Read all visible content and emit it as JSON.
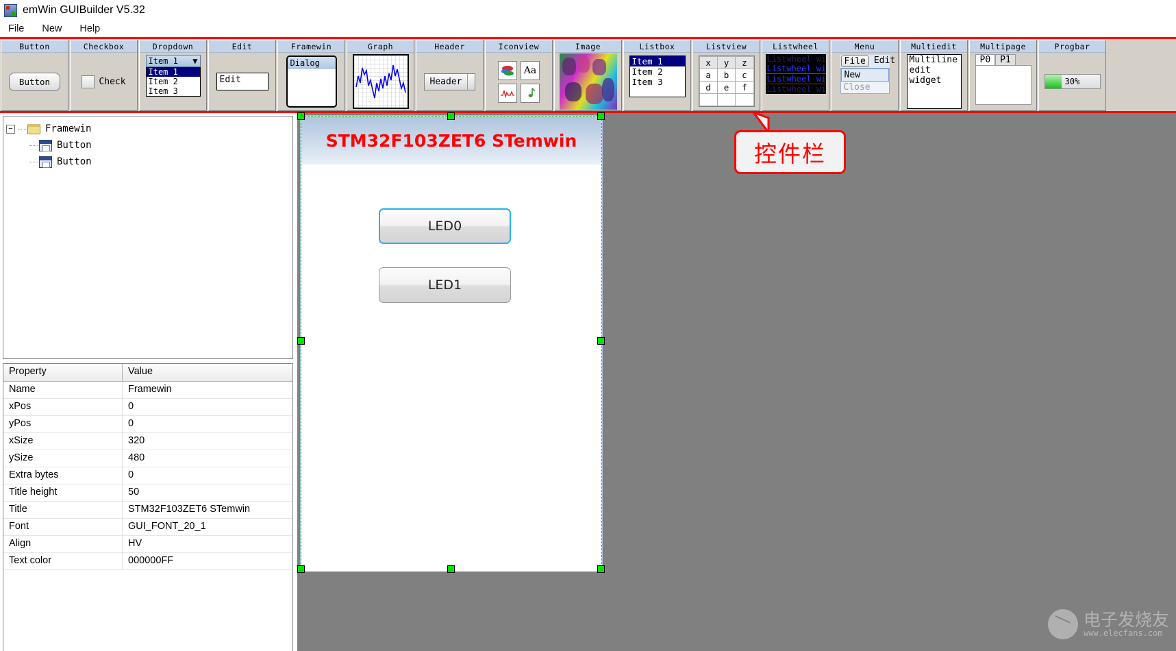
{
  "app": {
    "title": "emWin GUIBuilder V5.32",
    "icon": "app-icon"
  },
  "menubar": {
    "items": [
      {
        "label": "File"
      },
      {
        "label": "New"
      },
      {
        "label": "Help"
      }
    ]
  },
  "palette": {
    "accent_border": "#ff0000",
    "widgets": [
      {
        "title": "Button",
        "button_label": "Button"
      },
      {
        "title": "Checkbox",
        "check_label": "Check"
      },
      {
        "title": "Dropdown",
        "selected": "Item 1",
        "items": [
          "Item 1",
          "Item 2",
          "Item 3"
        ]
      },
      {
        "title": "Edit",
        "edit_value": "Edit"
      },
      {
        "title": "Framewin",
        "dialog_label": "Dialog"
      },
      {
        "title": "Graph"
      },
      {
        "title": "Header",
        "header_label": "Header"
      },
      {
        "title": "Iconview"
      },
      {
        "title": "Image"
      },
      {
        "title": "Listbox",
        "items": [
          "Item 1",
          "Item 2",
          "Item 3"
        ]
      },
      {
        "title": "Listview",
        "columns": [
          "x",
          "y",
          "z"
        ],
        "rows": [
          [
            "a",
            "b",
            "c"
          ],
          [
            "d",
            "e",
            "f"
          ]
        ]
      },
      {
        "title": "Listwheel",
        "items": [
          "Listwheel wi",
          "Listwheel wi",
          "Listwheel wi",
          "Listwheel wi"
        ]
      },
      {
        "title": "Menu",
        "bar": [
          "File",
          "Edit"
        ],
        "popup": [
          "New",
          "Close"
        ]
      },
      {
        "title": "Multiedit",
        "lines": [
          "Multiline",
          "edit",
          "widget"
        ]
      },
      {
        "title": "Multipage",
        "tabs": [
          "P0",
          "P1"
        ]
      },
      {
        "title": "Progbar",
        "percent_label": "30%",
        "percent": 30
      }
    ]
  },
  "tree": {
    "root": {
      "label": "Framewin",
      "expander": "−"
    },
    "children": [
      {
        "label": "Button"
      },
      {
        "label": "Button"
      }
    ]
  },
  "properties": {
    "header": {
      "property": "Property",
      "value": "Value"
    },
    "rows": [
      {
        "key": "Name",
        "value": "Framewin"
      },
      {
        "key": "xPos",
        "value": "0"
      },
      {
        "key": "yPos",
        "value": "0"
      },
      {
        "key": "xSize",
        "value": "320"
      },
      {
        "key": "ySize",
        "value": "480"
      },
      {
        "key": "Extra bytes",
        "value": "0"
      },
      {
        "key": "Title height",
        "value": "50"
      },
      {
        "key": "Title",
        "value": "STM32F103ZET6 STemwin"
      },
      {
        "key": "Font",
        "value": "GUI_FONT_20_1"
      },
      {
        "key": "Align",
        "value": "HV"
      },
      {
        "key": "Text color",
        "value": "000000FF"
      }
    ]
  },
  "design": {
    "title": "STM32F103ZET6 STemwin",
    "title_color": "#ff0000",
    "buttons": [
      {
        "label": "LED0",
        "focused": true
      },
      {
        "label": "LED1",
        "focused": false
      }
    ]
  },
  "annotation": {
    "text": "控件栏",
    "color": "#ff0000"
  },
  "watermark": {
    "name": "电子发烧友",
    "url": "www.elecfans.com"
  }
}
